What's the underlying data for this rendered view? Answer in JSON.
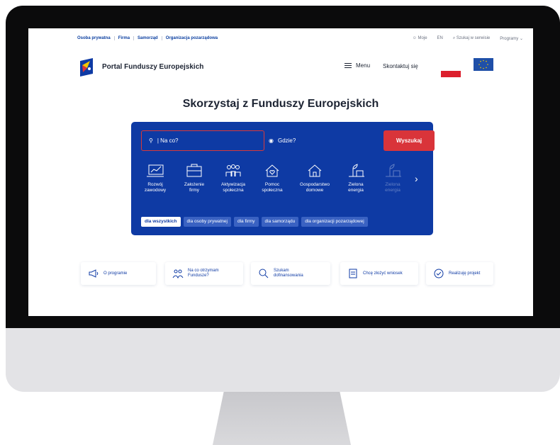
{
  "topbar": {
    "audiences": [
      "Osoba prywatna",
      "Firma",
      "Samorząd",
      "Organizacja pozarządowa"
    ],
    "right": [
      "Moje",
      "EN",
      "Szukaj w serwisie",
      "Programy"
    ]
  },
  "header": {
    "logo_text": "Portal Funduszy Europejskich",
    "menu_label": "Menu",
    "contact_label": "Skontaktuj się"
  },
  "hero": {
    "title": "Skorzystaj z Funduszy Europejskich"
  },
  "search": {
    "what_value": "| Na co?",
    "where_placeholder": "Gdzie?",
    "submit_label": "Wyszukaj"
  },
  "categories": [
    {
      "line1": "Rozwój",
      "line2": "zawodowy",
      "icon": "career-growth-icon"
    },
    {
      "line1": "Założenie",
      "line2": "firmy",
      "icon": "briefcase-icon"
    },
    {
      "line1": "Aktywizacja",
      "line2": "społeczna",
      "icon": "people-group-icon"
    },
    {
      "line1": "Pomoc",
      "line2": "społeczna",
      "icon": "house-heart-icon"
    },
    {
      "line1": "Gospodarstwo",
      "line2": "domowe",
      "icon": "home-icon"
    },
    {
      "line1": "Zielona",
      "line2": "energia",
      "icon": "green-energy-icon"
    },
    {
      "line1": "Zielona",
      "line2": "energia",
      "icon": "green-energy-icon"
    }
  ],
  "filters": [
    "dla wszystkich",
    "dla osoby prywatnej",
    "dla firmy",
    "dla samorządu",
    "dla organizacji pozarządowej"
  ],
  "quick_links": [
    {
      "line1": "O programie",
      "line2": "",
      "icon": "megaphone-icon"
    },
    {
      "line1": "Na co otrzymam",
      "line2": "Fundusze?",
      "icon": "people-icon"
    },
    {
      "line1": "Szukam",
      "line2": "dofinansowania",
      "icon": "search-icon"
    },
    {
      "line1": "Chcę złożyć wniosek",
      "line2": "",
      "icon": "form-icon"
    },
    {
      "line1": "Realizuję projekt",
      "line2": "",
      "icon": "clock-check-icon"
    }
  ],
  "colors": {
    "brand_blue": "#0e3aa4",
    "accent_red": "#d9343a",
    "poland_red": "#dc1f2d",
    "eu_blue": "#1f4fa8"
  }
}
